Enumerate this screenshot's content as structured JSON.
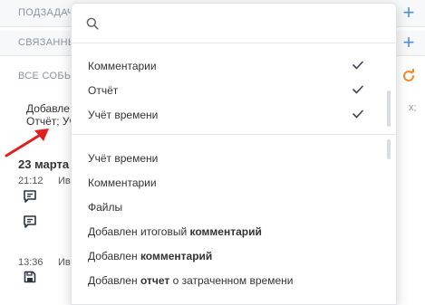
{
  "sections": {
    "subtasks_label": "ПОДЗАДАЧИ",
    "related_label": "СВЯЗАННЫЕ",
    "events_label": "ВСЕ СОБЫТИЯ"
  },
  "events": {
    "added_prefix": "Добавле",
    "right_stub": "х;",
    "filter_prefix": "Отчёт; Уч",
    "date_heading": "23 марта",
    "entries": [
      {
        "time": "21:12",
        "author_stub": "Ив"
      },
      {
        "time": "13:36",
        "author_stub": "Ив"
      }
    ]
  },
  "dropdown": {
    "search_placeholder": "",
    "selected": [
      {
        "label": "Комментарии"
      },
      {
        "label": "Отчёт"
      },
      {
        "label": "Учёт времени"
      }
    ],
    "options": [
      {
        "label": "Учёт времени"
      },
      {
        "label": "Комментарии"
      },
      {
        "label": "Файлы"
      },
      {
        "prefix": "Добавлен итоговый ",
        "bold": "комментарий",
        "suffix": ""
      },
      {
        "prefix": "Добавлен ",
        "bold": "комментарий",
        "suffix": ""
      },
      {
        "prefix": "Добавлен ",
        "bold": "отчет",
        "suffix": " о затраченном времени"
      }
    ]
  },
  "colors": {
    "accent_blue": "#4a90d9",
    "refresh_orange": "#f28c28",
    "arrow_red": "#e02020"
  }
}
